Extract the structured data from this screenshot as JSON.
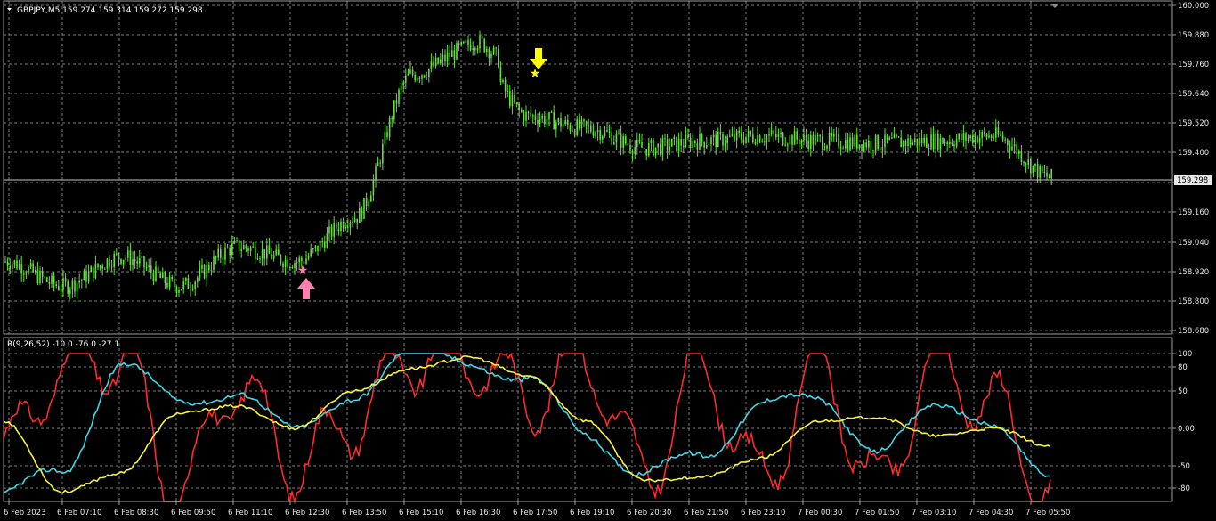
{
  "colors": {
    "background": "#000000",
    "grid": "#7a7a7a",
    "frame": "#9a9a9a",
    "candle": "#66e03a",
    "oscillator_red": "#ff2a2a",
    "oscillator_cyan": "#3fd6e6",
    "oscillator_yellow": "#f7f23a",
    "signal_up": "#ff7fb0",
    "signal_down": "#ffff00",
    "label_text": "#e6e6e6",
    "price_box_bg": "#e8e8e8",
    "price_box_text": "#000000"
  },
  "main": {
    "header": "GBPJPY,M5  159.274 159.314 159.272 159.298",
    "price_ticks": [
      "160.000",
      "159.880",
      "159.760",
      "159.640",
      "159.520",
      "159.400",
      "159.280",
      "159.160",
      "159.040",
      "158.920",
      "158.800",
      "158.680"
    ],
    "current_price": "159.298",
    "signals": [
      {
        "type": "buy",
        "icon": "pink-star-up-arrow-icon"
      },
      {
        "type": "sell",
        "icon": "yellow-star-down-arrow-icon"
      }
    ]
  },
  "oscillator": {
    "header": "R(9,26,52) -10.0 -76.0 -27.1",
    "ticks": [
      "100",
      "80",
      "50",
      "0.00",
      "-50",
      "-80"
    ]
  },
  "time_labels": [
    "6 Feb 2023",
    "6 Feb 07:10",
    "6 Feb 08:30",
    "6 Feb 09:50",
    "6 Feb 11:10",
    "6 Feb 12:30",
    "6 Feb 13:50",
    "6 Feb 15:10",
    "6 Feb 16:30",
    "6 Feb 17:50",
    "6 Feb 19:10",
    "6 Feb 20:30",
    "6 Feb 21:50",
    "6 Feb 23:10",
    "7 Feb 00:30",
    "7 Feb 01:50",
    "7 Feb 03:10",
    "7 Feb 04:30",
    "7 Feb 05:50"
  ],
  "chart_data": [
    {
      "type": "candlestick",
      "title": "GBPJPY,M5  159.274 159.314 159.272 159.298",
      "ylim": [
        158.65,
        160.0
      ],
      "x": [
        "6 Feb 2023",
        "6 Feb 07:10",
        "6 Feb 08:30",
        "6 Feb 09:50",
        "6 Feb 11:10",
        "6 Feb 12:30",
        "6 Feb 13:50",
        "6 Feb 15:10",
        "6 Feb 16:30",
        "6 Feb 17:50",
        "6 Feb 19:10",
        "6 Feb 20:30",
        "6 Feb 21:50",
        "6 Feb 23:10",
        "7 Feb 00:30",
        "7 Feb 01:50",
        "7 Feb 03:10",
        "7 Feb 04:30",
        "7 Feb 05:50"
      ],
      "series": [
        {
          "values": [
            158.96,
            158.86,
            158.98,
            158.86,
            159.02,
            158.96,
            159.14,
            159.72,
            159.83,
            159.55,
            159.5,
            159.42,
            159.45,
            159.47,
            159.45,
            159.44,
            159.45,
            159.47,
            159.3
          ]
        }
      ],
      "grid": true
    },
    {
      "type": "line",
      "title": "R(9,26,52) -10.0 -76.0 -27.1",
      "ylim": [
        -100,
        100
      ],
      "x": [
        "6 Feb 2023",
        "6 Feb 07:10",
        "6 Feb 08:30",
        "6 Feb 09:50",
        "6 Feb 11:10",
        "6 Feb 12:30",
        "6 Feb 13:50",
        "6 Feb 15:10",
        "6 Feb 16:30",
        "6 Feb 17:50",
        "6 Feb 19:10",
        "6 Feb 20:30",
        "6 Feb 21:50",
        "6 Feb 23:10",
        "7 Feb 00:30",
        "7 Feb 01:50",
        "7 Feb 03:10",
        "7 Feb 04:30",
        "7 Feb 05:50"
      ],
      "series": [
        {
          "values": [
            -30,
            80,
            95,
            -85,
            60,
            -50,
            10,
            95,
            95,
            40,
            90,
            -60,
            80,
            -70,
            85,
            -80,
            85,
            30,
            -90
          ]
        },
        {
          "values": [
            -90,
            -60,
            90,
            30,
            55,
            -10,
            50,
            98,
            95,
            60,
            -5,
            -60,
            -40,
            40,
            30,
            -20,
            20,
            15,
            -75
          ]
        },
        {
          "values": [
            10,
            -85,
            -60,
            20,
            30,
            0,
            50,
            80,
            95,
            70,
            10,
            -70,
            -65,
            -40,
            10,
            15,
            -10,
            0,
            -25
          ]
        }
      ],
      "grid": true
    }
  ]
}
